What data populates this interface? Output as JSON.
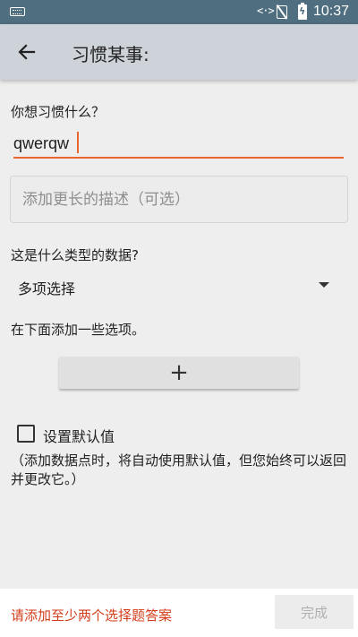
{
  "status_bar": {
    "time": "10:37",
    "network_indicator": "<·>",
    "icons": [
      "keyboard-icon",
      "data-transfer-icon",
      "no-signal-icon",
      "battery-charging-icon"
    ]
  },
  "app_bar": {
    "title": "习惯某事:",
    "back_icon": "arrow-back-icon"
  },
  "form": {
    "question_label": "你想习惯什么？",
    "name_value": "qwerqw",
    "description_placeholder": "添加更长的描述（可选）",
    "type_label": "这是什么类型的数据?",
    "type_selected": "多项选择",
    "options_label": "在下面添加一些选项。",
    "add_option_symbol": "+",
    "default_label": "设置默认值",
    "default_checked": false,
    "default_help": "（添加数据点时，将自动使用默认值，但您始终可以返回并更改它。）"
  },
  "footer": {
    "error_text": "请添加至少两个选择题答案",
    "done_label": "完成",
    "done_enabled": false
  },
  "colors": {
    "status_bar": "#4f6e80",
    "app_bar": "#cdd3d8",
    "accent": "#e9672f",
    "error": "#d33d1a",
    "background": "#eeeeee"
  }
}
